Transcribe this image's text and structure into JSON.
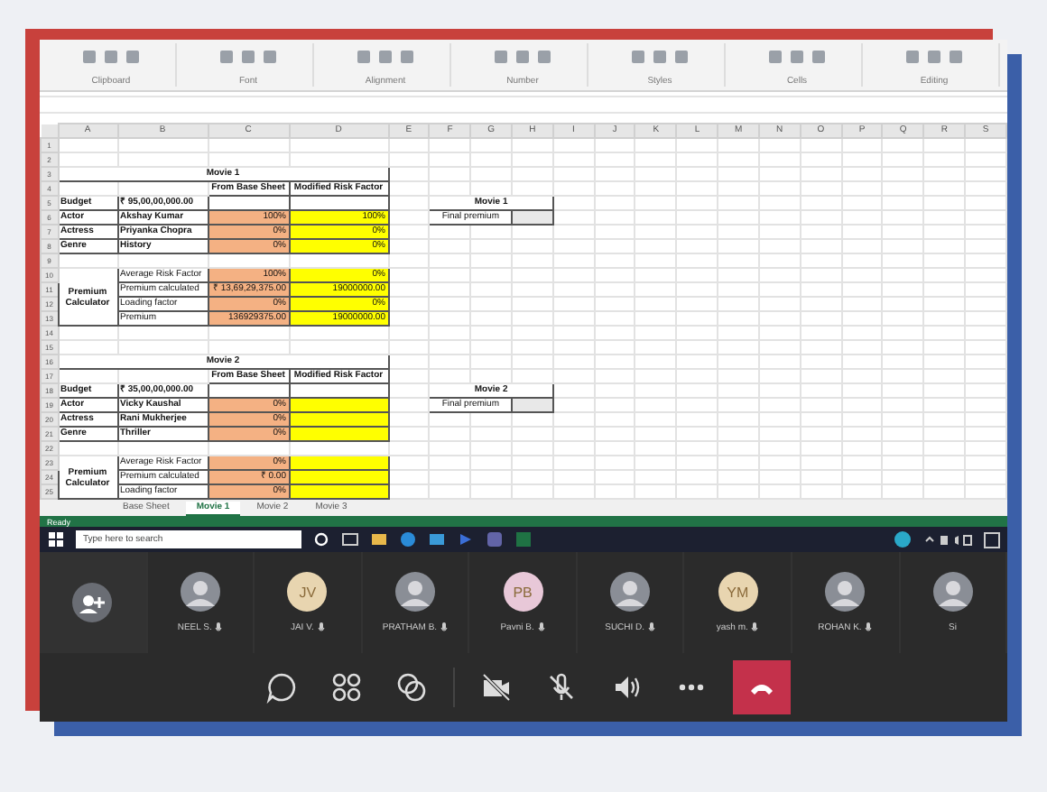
{
  "ribbon": {
    "groups": [
      "Clipboard",
      "Font",
      "Alignment",
      "Number",
      "Styles",
      "Cells",
      "Editing"
    ]
  },
  "sheet": {
    "columns": [
      "A",
      "B",
      "C",
      "D",
      "E",
      "F",
      "G",
      "H",
      "I",
      "J",
      "K",
      "L",
      "M",
      "N",
      "O",
      "P",
      "Q",
      "R",
      "S"
    ],
    "row_numbers": [
      "1",
      "2",
      "3",
      "4",
      "5",
      "6",
      "7",
      "8",
      "9",
      "10",
      "11",
      "12",
      "13",
      "14",
      "15",
      "16",
      "17",
      "18",
      "19",
      "20",
      "21",
      "22",
      "23",
      "24",
      "25"
    ],
    "movies": [
      {
        "title": "Movie 1",
        "headers": [
          "From Base Sheet",
          "Modified Risk Factor"
        ],
        "budget": {
          "label": "Budget",
          "value": "₹ 95,00,00,000.00"
        },
        "factors": [
          {
            "label": "Actor",
            "value": "Akshay Kumar",
            "base": "100%",
            "modified": "100%"
          },
          {
            "label": "Actress",
            "value": "Priyanka Chopra",
            "base": "0%",
            "modified": "0%"
          },
          {
            "label": "Genre",
            "value": "History",
            "base": "0%",
            "modified": "0%"
          }
        ],
        "calculator": {
          "label": "Premium Calculator",
          "rows": [
            {
              "label": "Average Risk Factor",
              "base": "100%",
              "modified": "0%"
            },
            {
              "label": "Premium calculated",
              "base": "₹ 13,69,29,375.00",
              "modified": "19000000.00"
            },
            {
              "label": "Loading factor",
              "base": "0%",
              "modified": "0%"
            },
            {
              "label": "Premium",
              "base": "136929375.00",
              "modified": "19000000.00"
            }
          ]
        },
        "summary": {
          "title": "Movie 1",
          "label": "Final premium"
        }
      },
      {
        "title": "Movie 2",
        "headers": [
          "From Base Sheet",
          "Modified Risk Factor"
        ],
        "budget": {
          "label": "Budget",
          "value": "₹ 35,00,00,000.00"
        },
        "factors": [
          {
            "label": "Actor",
            "value": "Vicky Kaushal",
            "base": "0%"
          },
          {
            "label": "Actress",
            "value": "Rani Mukherjee",
            "base": "0%"
          },
          {
            "label": "Genre",
            "value": "Thriller",
            "base": "0%"
          }
        ],
        "calculator": {
          "label": "Premium Calculator",
          "rows": [
            {
              "label": "Average Risk Factor",
              "base": "0%"
            },
            {
              "label": "Premium calculated",
              "base": "₹ 0.00"
            },
            {
              "label": "Loading factor",
              "base": "0%"
            }
          ]
        },
        "summary": {
          "title": "Movie 2",
          "label": "Final premium"
        }
      }
    ]
  },
  "sheet_tabs": [
    {
      "label": "Base Sheet",
      "selected": false
    },
    {
      "label": "Movie 1",
      "selected": true
    },
    {
      "label": "Movie 2",
      "selected": false
    },
    {
      "label": "Movie 3",
      "selected": false
    }
  ],
  "status_bar": {
    "text": "Ready"
  },
  "taskbar": {
    "search": {
      "placeholder": "Type here to search"
    }
  },
  "participants": [
    {
      "kind": "icon"
    },
    {
      "kind": "photo",
      "name": "NEEL S."
    },
    {
      "kind": "initials",
      "initials": "JV",
      "color": "#e8d5b0",
      "name": "JAI V."
    },
    {
      "kind": "photo",
      "name": "PRATHAM B."
    },
    {
      "kind": "initials",
      "initials": "PB",
      "color": "#e8c8d8",
      "name": "Pavni B."
    },
    {
      "kind": "photo",
      "name": "SUCHI D."
    },
    {
      "kind": "initials",
      "initials": "YM",
      "color": "#e8d5b0",
      "name": "yash m."
    },
    {
      "kind": "photo",
      "name": "ROHAN K."
    },
    {
      "kind": "photo",
      "name": "Si"
    }
  ],
  "controls": [
    {
      "kind": "chat"
    },
    {
      "kind": "people"
    },
    {
      "kind": "share"
    },
    {
      "kind": "camera-off"
    },
    {
      "kind": "mic-off"
    },
    {
      "kind": "speaker"
    },
    {
      "kind": "more"
    },
    {
      "kind": "hang-up"
    }
  ]
}
